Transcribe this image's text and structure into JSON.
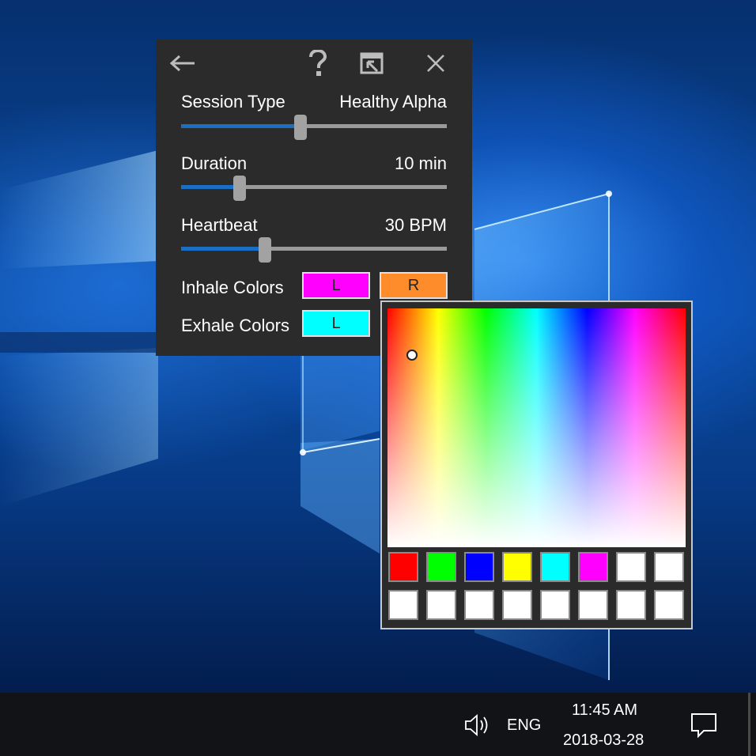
{
  "panel": {
    "back_icon": "back-arrow-icon",
    "help_icon": "question-mark-icon",
    "restore_icon": "window-restore-icon",
    "close_icon": "close-icon",
    "session": {
      "label": "Session Type",
      "value": "Healthy Alpha",
      "level": 0.45
    },
    "duration": {
      "label": "Duration",
      "value": "10 min",
      "level": 0.22
    },
    "heartbeat": {
      "label": "Heartbeat",
      "value": "30 BPM",
      "level": 0.315
    },
    "inhale": {
      "label": "Inhale Colors",
      "left": "L",
      "right": "R",
      "left_color": "#ff00ff",
      "right_color": "#ff8c2a"
    },
    "exhale": {
      "label": "Exhale Colors",
      "left": "L",
      "left_color": "#00ffff"
    }
  },
  "picker": {
    "presets": [
      "#ff0000",
      "#00ff00",
      "#0000ff",
      "#ffff00",
      "#00ffff",
      "#ff00ff",
      "#ffffff",
      "#ffffff",
      "#ffffff",
      "#ffffff",
      "#ffffff",
      "#ffffff",
      "#ffffff",
      "#ffffff",
      "#ffffff",
      "#ffffff"
    ]
  },
  "taskbar": {
    "volume_icon": "speaker-icon",
    "language": "ENG",
    "time": "11:45 AM",
    "date": "2018-03-28",
    "notification_icon": "action-center-icon"
  },
  "colors": {
    "accent": "#1a6fc4",
    "panel_bg": "#2b2b2b",
    "taskbar_bg": "#111317"
  }
}
